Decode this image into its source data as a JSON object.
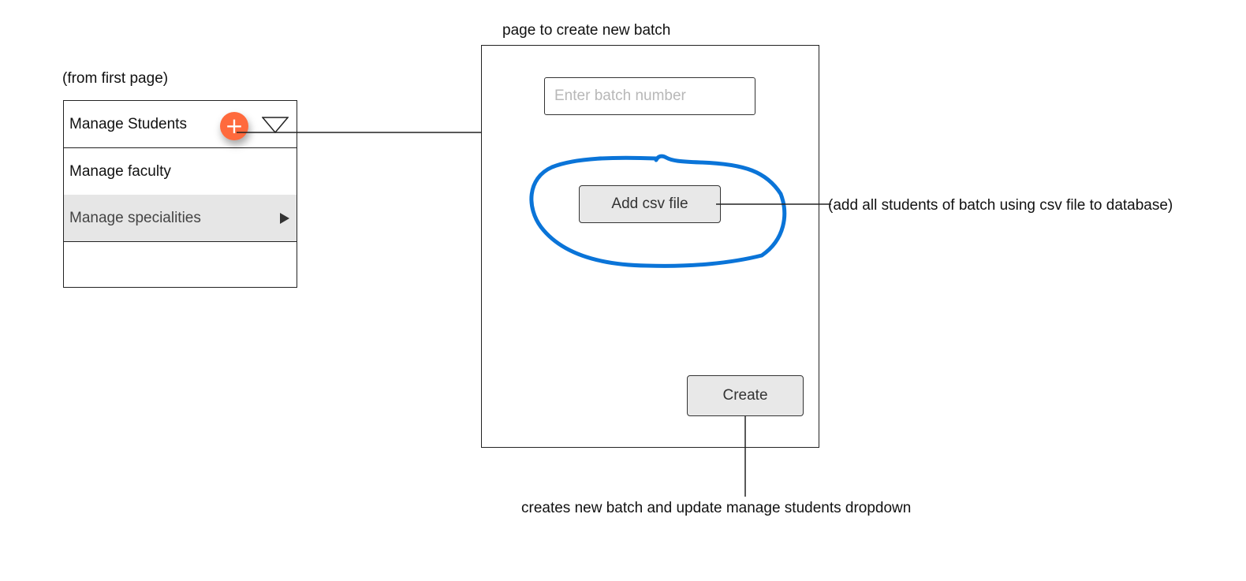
{
  "annotations": {
    "from_first_page": "(from first page)",
    "page_title": "page to create new batch",
    "csv_note": "(add all students of batch using csv file to database)",
    "create_note": "creates new batch and update manage students dropdown"
  },
  "menu": {
    "items": [
      {
        "label": "Manage Students",
        "icons": [
          "add-icon",
          "dropdown-triangle-icon"
        ]
      },
      {
        "label": "Manage faculty"
      },
      {
        "label": "Manage specialities",
        "icons": [
          "submenu-arrow-icon"
        ],
        "state": "highlighted"
      },
      {
        "label": ""
      }
    ],
    "add_symbol": "+"
  },
  "form": {
    "batch_placeholder": "Enter batch number",
    "csv_button_label": "Add csv file",
    "create_button_label": "Create"
  },
  "colors": {
    "accent_orange": "#ff6a3d",
    "highlight_blue": "#0a74d8",
    "highlight_row": "#e6e6e6"
  }
}
